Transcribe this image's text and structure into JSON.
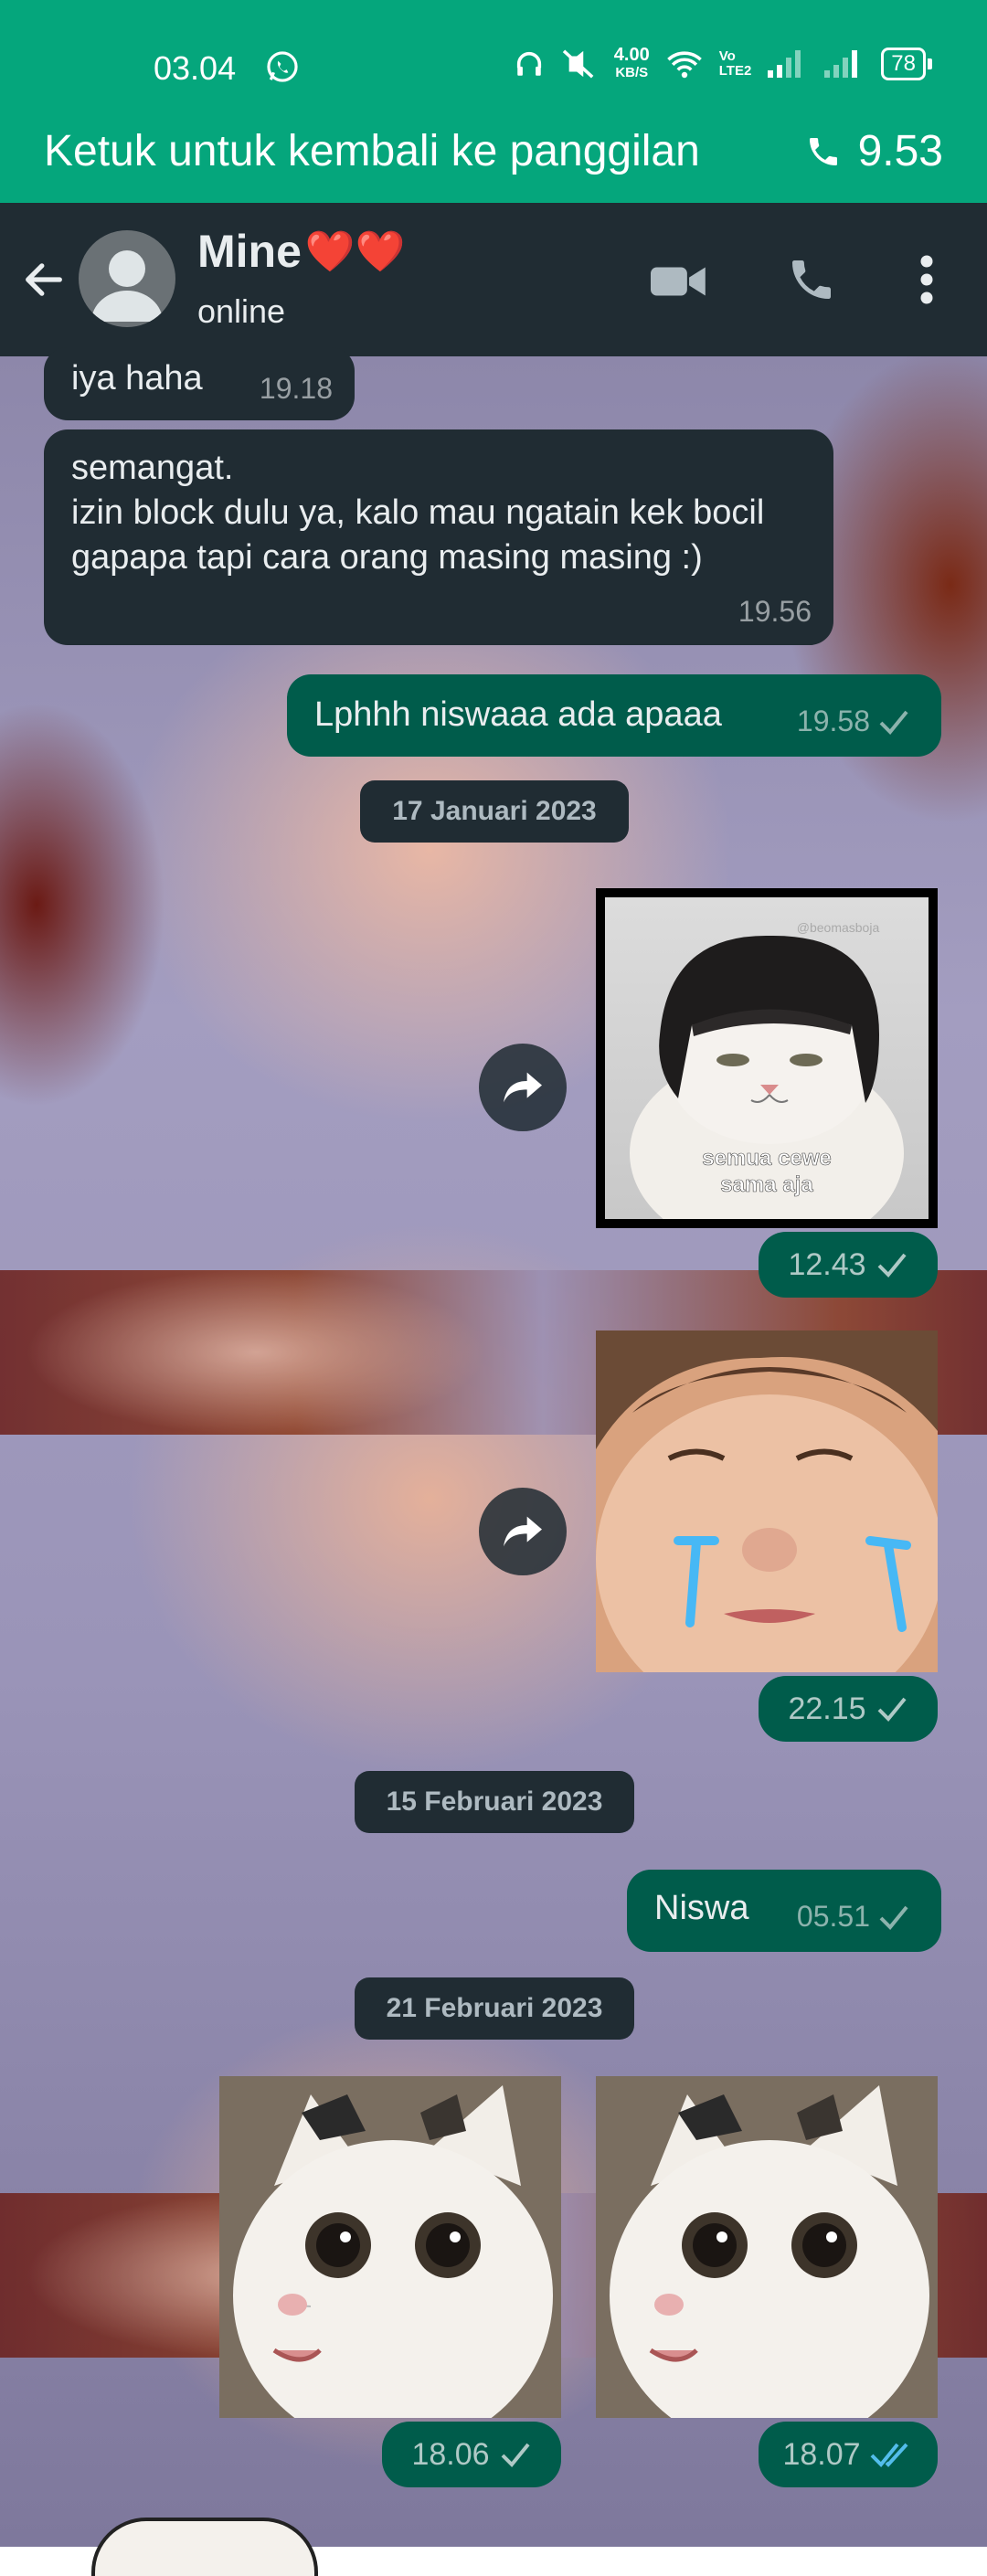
{
  "status_bar": {
    "time": "03.04",
    "net_speed_value": "4.00",
    "net_speed_unit": "KB/S",
    "volte": "Vo\nLTE2",
    "battery": "78"
  },
  "call_banner": {
    "text": "Ketuk untuk kembali ke panggilan",
    "duration": "9.53"
  },
  "header": {
    "contact_name": "Mine",
    "contact_emoji": "❤️❤️",
    "status": "online"
  },
  "messages": [
    {
      "kind": "in",
      "text": "iya haha",
      "time": "19.18"
    },
    {
      "kind": "in",
      "text": "semangat.\nizin block dulu ya, kalo mau ngatain kek bocil gapapa tapi cara orang masing masing :)",
      "time": "19.56"
    },
    {
      "kind": "out",
      "text": "Lphhh niswaaa ada apaaa",
      "time": "19.58",
      "ticks": "sent"
    },
    {
      "kind": "date",
      "text": "17 Januari 2023"
    },
    {
      "kind": "sticker",
      "caption": "semua cewe\nsama aja",
      "watermark": "@beomasboja",
      "time": "12.43",
      "ticks": "sent"
    },
    {
      "kind": "sticker",
      "time": "22.15",
      "ticks": "sent"
    },
    {
      "kind": "date",
      "text": "15 Februari 2023"
    },
    {
      "kind": "out",
      "text": "Niswa",
      "time": "05.51",
      "ticks": "sent"
    },
    {
      "kind": "date",
      "text": "21 Februari 2023"
    },
    {
      "kind": "sticker",
      "time": "18.06",
      "ticks": "sent"
    },
    {
      "kind": "sticker",
      "time": "18.07",
      "ticks": "read"
    }
  ],
  "colors": {
    "status_green": "#05a67c",
    "header_bg": "#202c33",
    "incoming_bubble": "#202c33",
    "outgoing_bubble": "#005c4b",
    "read_tick": "#53bdeb"
  }
}
